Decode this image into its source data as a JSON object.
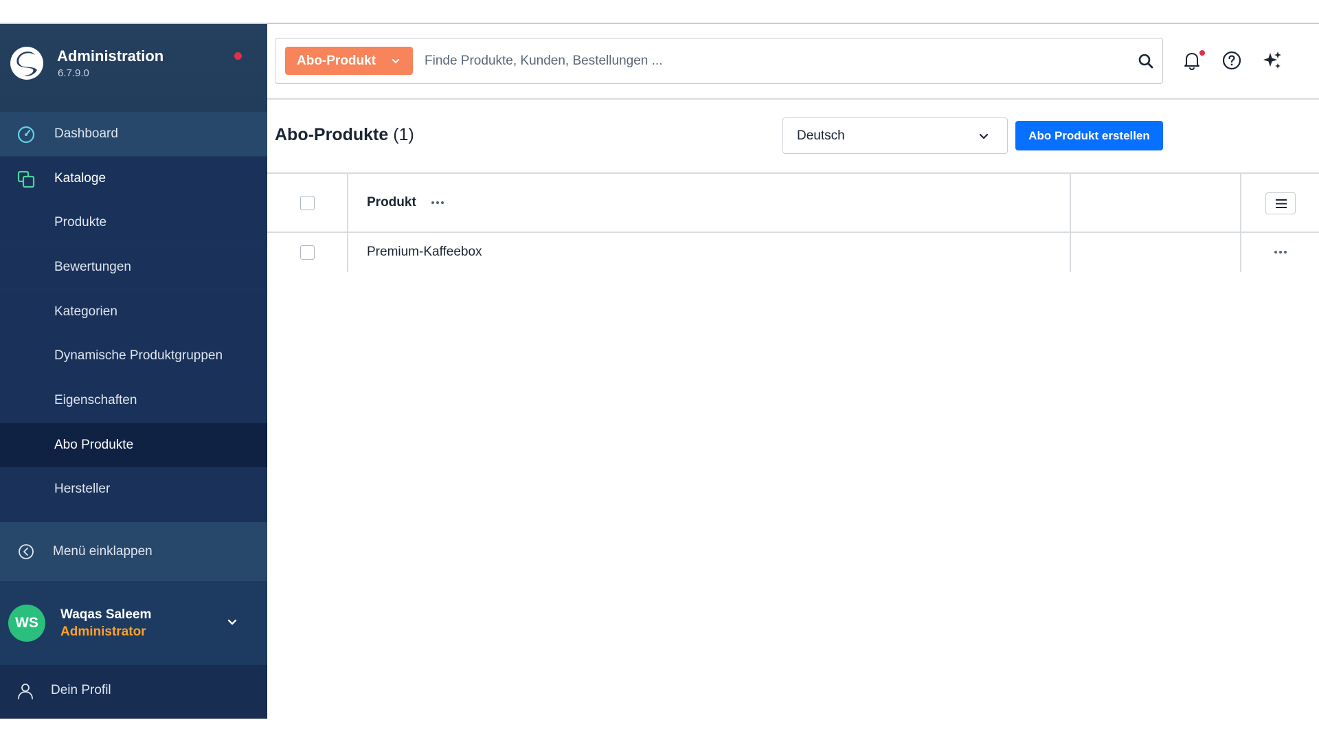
{
  "app": {
    "title": "Administration",
    "version": "6.7.9.0"
  },
  "sidebar": {
    "items": [
      {
        "label": "Dashboard"
      },
      {
        "label": "Kataloge"
      }
    ],
    "sub_items": [
      {
        "label": "Produkte"
      },
      {
        "label": "Bewertungen"
      },
      {
        "label": "Kategorien"
      },
      {
        "label": "Dynamische Produktgruppen"
      },
      {
        "label": "Eigenschaften"
      },
      {
        "label": "Abo Produkte",
        "active": true
      },
      {
        "label": "Hersteller"
      }
    ],
    "collapse_label": "Menü einklappen",
    "profile_label": "Dein Profil"
  },
  "user": {
    "initials": "WS",
    "name": "Waqas Saleem",
    "role": "Administrator"
  },
  "header": {
    "search_type": "Abo-Produkt",
    "search_placeholder": "Finde Produkte, Kunden, Bestellungen ...",
    "search_value": ""
  },
  "page": {
    "title": "Abo-Produkte",
    "count": "(1)",
    "language": "Deutsch",
    "create_button": "Abo Produkt erstellen"
  },
  "table": {
    "columns": [
      "Produkt"
    ],
    "rows": [
      {
        "product": "Premium-Kaffeebox"
      }
    ]
  },
  "colors": {
    "sidebar": "#1c3459",
    "accent_orange": "#f7845a",
    "primary_blue": "#0870ff",
    "avatar_green": "#2bbf7e",
    "role_orange": "#ffa02e",
    "notification_red": "#e0304a"
  }
}
